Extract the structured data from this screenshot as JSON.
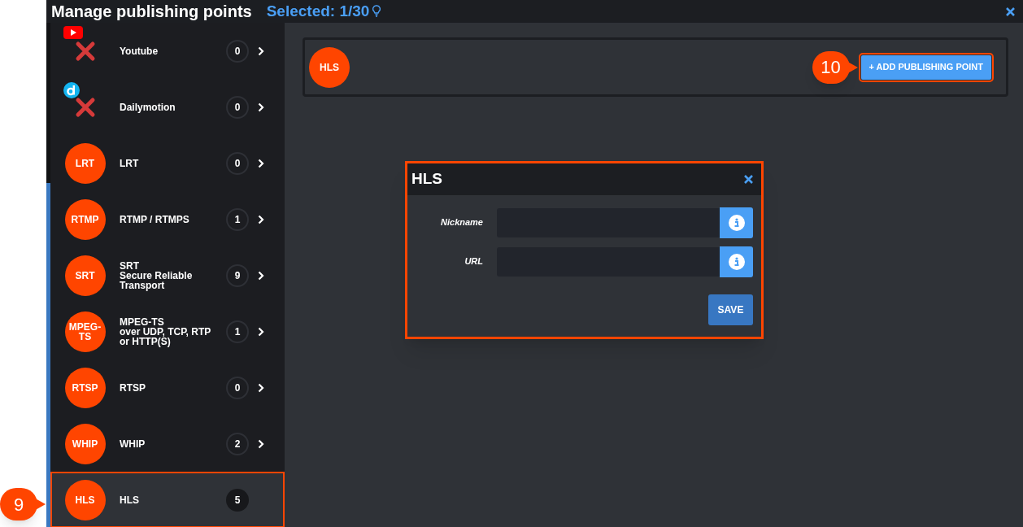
{
  "header": {
    "title": "Manage publishing points",
    "selection": "Selected: 1/30"
  },
  "sidebar": {
    "items": [
      {
        "kind": "platform",
        "logo": {
          "kind": "play"
        },
        "unavailable": true,
        "label": "Youtube",
        "count": "0",
        "selected": false
      },
      {
        "kind": "platform",
        "logo": {
          "kind": "ring"
        },
        "unavailable": true,
        "label": "Dailymotion",
        "count": "0",
        "selected": false
      },
      {
        "kind": "protocol",
        "badge": "LRT",
        "label": "LRT",
        "count": "0",
        "selected": false
      },
      {
        "kind": "protocol",
        "badge": "RTMP",
        "label": "RTMP / RTMPS",
        "count": "1",
        "selected": false
      },
      {
        "kind": "protocol",
        "badge": "SRT",
        "label": "SRT\nSecure Reliable\nTransport",
        "count": "9",
        "selected": false
      },
      {
        "kind": "protocol",
        "badge": "MPEG-\nTS",
        "label": "MPEG-TS\nover UDP, TCP, RTP\nor HTTP(S)",
        "count": "1",
        "selected": false
      },
      {
        "kind": "protocol",
        "badge": "RTSP",
        "label": "RTSP",
        "count": "0",
        "selected": false
      },
      {
        "kind": "protocol",
        "badge": "WHIP",
        "label": "WHIP",
        "count": "2",
        "selected": false
      },
      {
        "kind": "protocol",
        "badge": "HLS",
        "label": "HLS",
        "count": "5",
        "selected": true
      }
    ]
  },
  "panel": {
    "badge": "HLS",
    "add_button": "+ ADD PUBLISHING POINT"
  },
  "dialog": {
    "title": "HLS",
    "fields": [
      {
        "label": "Nickname"
      },
      {
        "label": "URL"
      }
    ],
    "save_button": "SAVE"
  },
  "annotations": [
    {
      "label": "9"
    },
    {
      "label": "10"
    }
  ]
}
